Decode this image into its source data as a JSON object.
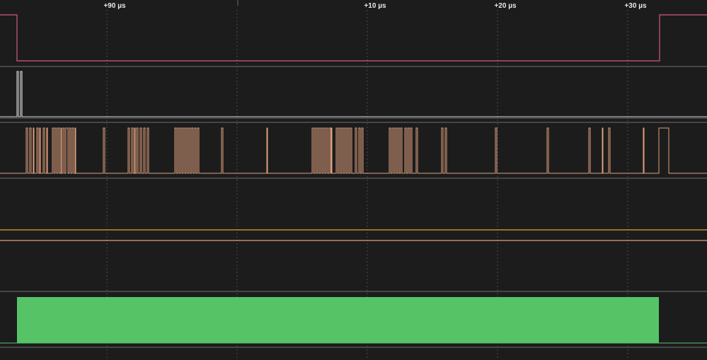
{
  "timeline": {
    "ticks": [
      "+90 µs",
      "+10 µs",
      "+20 µs",
      "+30 µs"
    ]
  },
  "colors": {
    "background": "#1c1c1d",
    "separator": "#5e5e60",
    "grid": "#4a4a4a",
    "tick_text": "#e8e8e8",
    "channel_enable": "#d35a78",
    "channel_clock": "#d9d9d9",
    "channel_data": "#e0a07c",
    "channel_bus": "#e5a23a",
    "analyzer_block": "#56c466"
  },
  "channels": [
    {
      "id": "enable",
      "level_at_start": "high",
      "level_in_capture": "low"
    },
    {
      "id": "clock",
      "pulses": 2
    },
    {
      "id": "data",
      "activity": "burst"
    },
    {
      "id": "idle",
      "activity": "none"
    },
    {
      "id": "bus",
      "activity": "constant"
    },
    {
      "id": "analyzer",
      "activity": "decoded-frame"
    }
  ]
}
